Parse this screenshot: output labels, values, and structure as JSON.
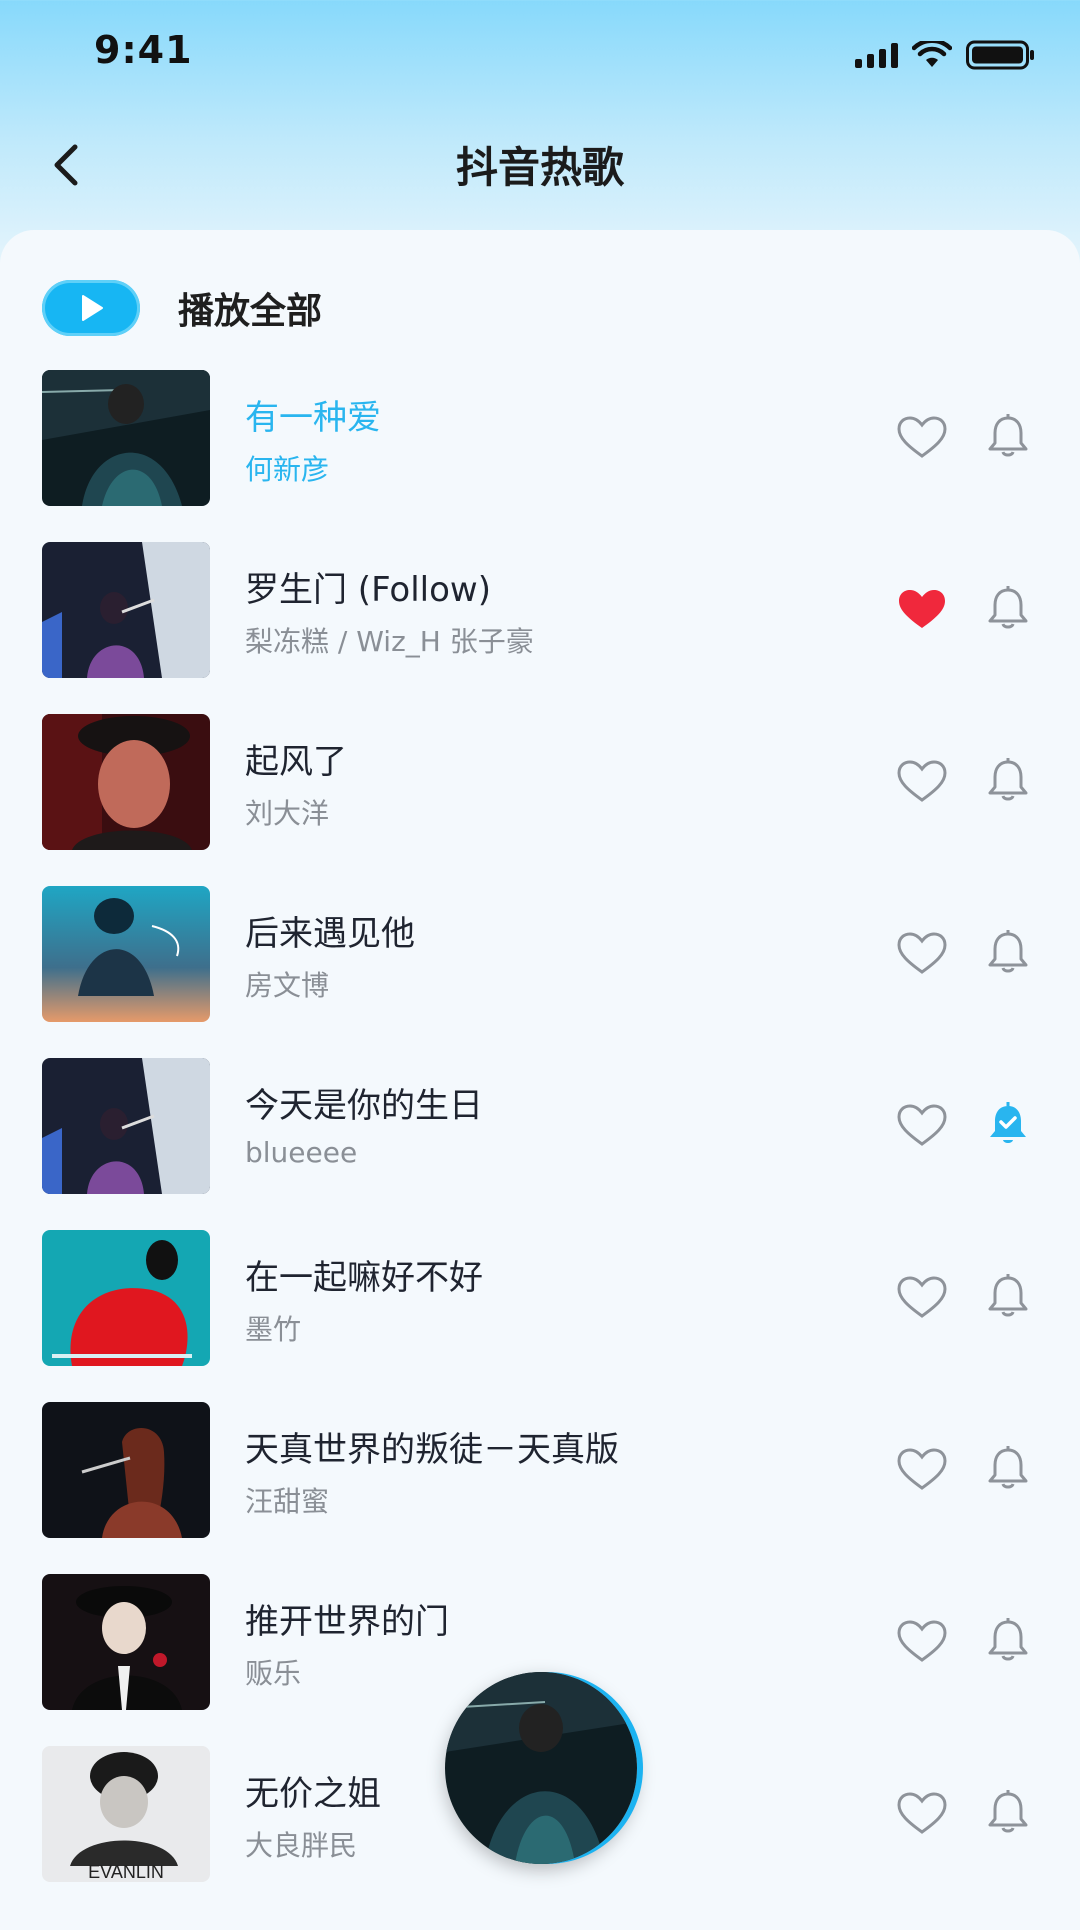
{
  "status_bar": {
    "time": "9:41"
  },
  "header": {
    "title": "抖音热歌",
    "back_icon": "chevron-left-icon"
  },
  "play_all": {
    "label": "播放全部",
    "icon": "play-icon"
  },
  "colors": {
    "accent": "#17b6f3",
    "liked": "#f0283c",
    "subscribed": "#29b5ef"
  },
  "songs": [
    {
      "title": "有一种爱",
      "artist": "何新彦",
      "playing": true,
      "liked": false,
      "subscribed": false,
      "cover": "concert-man-dark"
    },
    {
      "title": "罗生门 (Follow)",
      "artist": "梨冻糕 / Wiz_H 张子豪",
      "playing": false,
      "liked": true,
      "subscribed": false,
      "cover": "singer-purple-stage"
    },
    {
      "title": "起风了",
      "artist": "刘大洋",
      "playing": false,
      "liked": false,
      "subscribed": false,
      "cover": "man-red-portrait"
    },
    {
      "title": "后来遇见他",
      "artist": "房文博",
      "playing": false,
      "liked": false,
      "subscribed": false,
      "cover": "blue-orange-poster"
    },
    {
      "title": "今天是你的生日",
      "artist": "blueeee",
      "playing": false,
      "liked": false,
      "subscribed": true,
      "cover": "singer-purple-stage"
    },
    {
      "title": "在一起嘛好不好",
      "artist": "墨竹",
      "playing": false,
      "liked": false,
      "subscribed": false,
      "cover": "red-feather-poster"
    },
    {
      "title": "天真世界的叛徒－天真版",
      "artist": "汪甜蜜",
      "playing": false,
      "liked": false,
      "subscribed": false,
      "cover": "woman-singer-dark"
    },
    {
      "title": "推开世界的门",
      "artist": "贩乐",
      "playing": false,
      "liked": false,
      "subscribed": false,
      "cover": "singer-hat-mic"
    },
    {
      "title": "无价之姐",
      "artist": "大良胖民",
      "playing": false,
      "liked": false,
      "subscribed": false,
      "cover": "bw-portrait-evanlin",
      "cover_text": "EVANLIN"
    }
  ],
  "mini_player": {
    "cover": "concert-man-dark"
  }
}
